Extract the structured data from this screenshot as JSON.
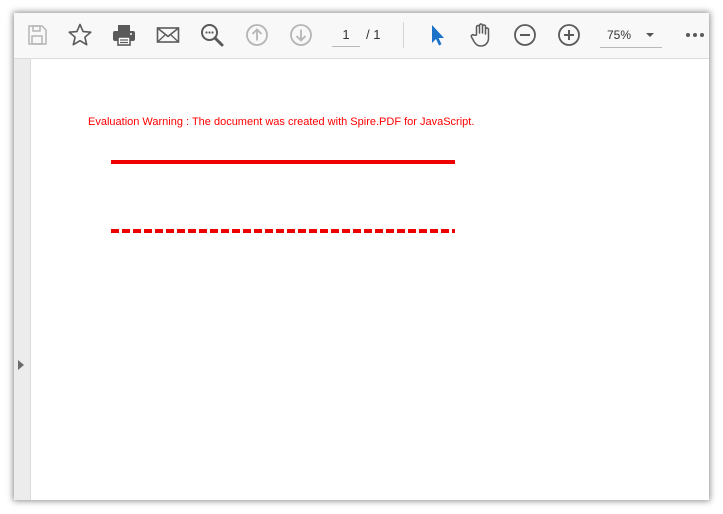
{
  "toolbar": {
    "buttons": [
      {
        "name": "save",
        "icon": "save-icon",
        "enabled": false
      },
      {
        "name": "bookmark",
        "icon": "star-icon",
        "enabled": true
      },
      {
        "name": "print",
        "icon": "printer-icon",
        "enabled": true
      },
      {
        "name": "email",
        "icon": "envelope-icon",
        "enabled": true
      },
      {
        "name": "search",
        "icon": "search-icon",
        "enabled": true
      },
      {
        "name": "previous-page",
        "icon": "arrow-up-circle-icon",
        "enabled": false
      },
      {
        "name": "next-page",
        "icon": "arrow-down-circle-icon",
        "enabled": false
      },
      {
        "name": "select-tool",
        "icon": "cursor-arrow-icon",
        "enabled": true
      },
      {
        "name": "hand-tool",
        "icon": "hand-icon",
        "enabled": true
      },
      {
        "name": "zoom-out",
        "icon": "minus-circle-icon",
        "enabled": true
      },
      {
        "name": "zoom-in",
        "icon": "plus-circle-icon",
        "enabled": true
      },
      {
        "name": "more-tools",
        "icon": "ellipsis-icon",
        "enabled": true
      }
    ],
    "page": {
      "current": "1",
      "total_label": "/ 1"
    },
    "zoom": {
      "value": "75%"
    }
  },
  "colors": {
    "accent": "#1a73c8",
    "icon": "#5a5a5a",
    "icon_disabled": "#b5b5b5",
    "warning_text": "#ff0000",
    "line": "#ee0000"
  },
  "document": {
    "warning_text": "Evaluation Warning : The document was created with Spire.PDF for JavaScript."
  }
}
